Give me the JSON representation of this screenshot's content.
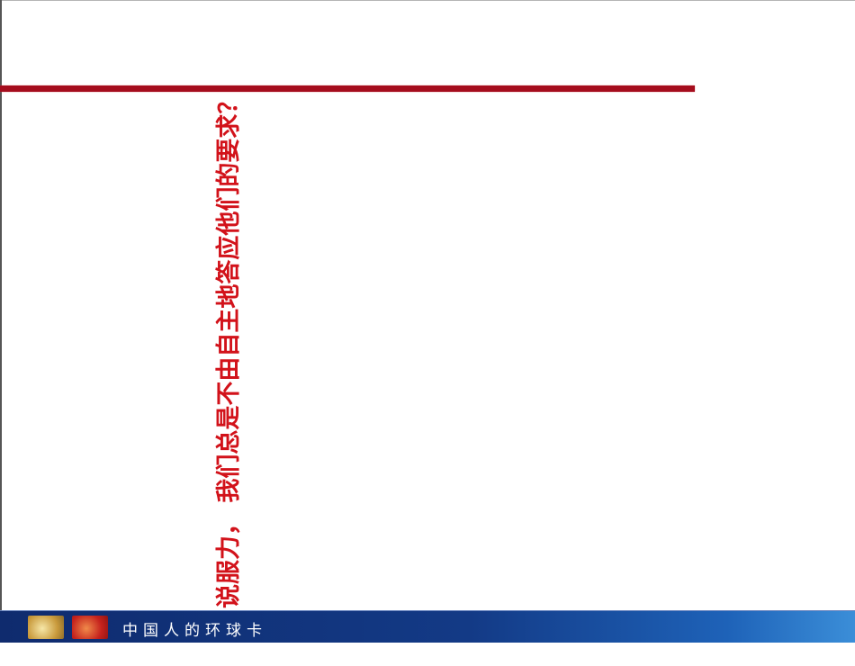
{
  "slide": {
    "vertical_text": "说服力， 我们总是不由自主地答应他们的要求？",
    "footer_slogan": "中国人的环球卡",
    "accent_color": "#a50d1d",
    "footer_color": "#133a86"
  }
}
